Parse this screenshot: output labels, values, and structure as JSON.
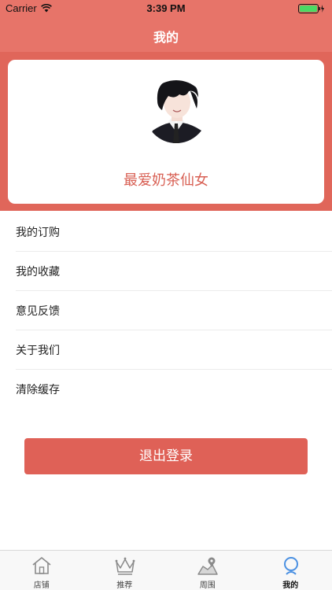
{
  "status_bar": {
    "carrier": "Carrier",
    "time": "3:39 PM",
    "battery_color": "#4cd964"
  },
  "nav": {
    "title": "我的"
  },
  "profile": {
    "username": "最爱奶茶仙女",
    "accent_color": "#e0665a"
  },
  "menu": {
    "items": [
      {
        "label": "我的订购"
      },
      {
        "label": "我的收藏"
      },
      {
        "label": "意见反馈"
      },
      {
        "label": "关于我们"
      },
      {
        "label": "清除缓存"
      }
    ]
  },
  "logout": {
    "label": "退出登录"
  },
  "tabbar": {
    "tabs": [
      {
        "label": "店铺",
        "icon": "home-icon"
      },
      {
        "label": "推荐",
        "icon": "crown-icon"
      },
      {
        "label": "周围",
        "icon": "map-pin-icon"
      },
      {
        "label": "我的",
        "icon": "user-icon",
        "active": true
      }
    ],
    "active_color": "#4a90e2"
  }
}
